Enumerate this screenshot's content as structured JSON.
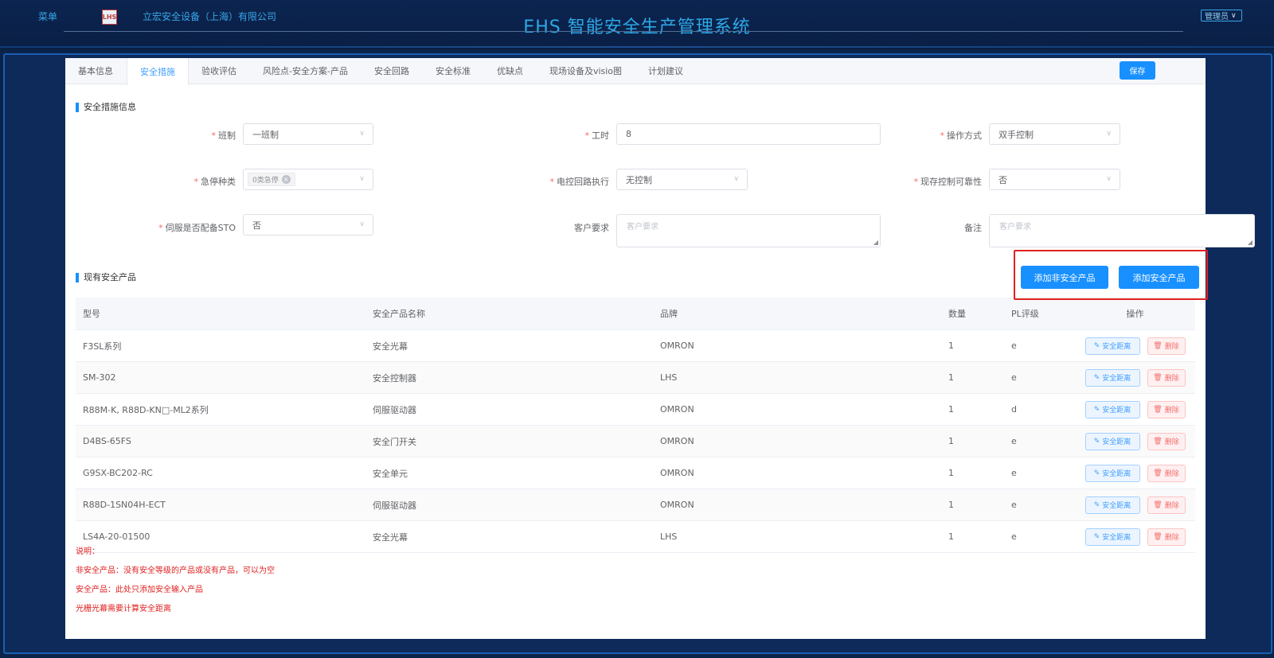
{
  "header": {
    "menu": "菜单",
    "logo_text": "LHS",
    "company": "立宏安全设备（上海）有限公司",
    "system_title": "EHS 智能安全生产管理系统",
    "user": "管理员"
  },
  "tabs": [
    {
      "label": "基本信息"
    },
    {
      "label": "安全措施",
      "active": true
    },
    {
      "label": "验收评估"
    },
    {
      "label": "风险点-安全方案-产品"
    },
    {
      "label": "安全回路"
    },
    {
      "label": "安全标准"
    },
    {
      "label": "优缺点"
    },
    {
      "label": "现场设备及visio图"
    },
    {
      "label": "计划建议"
    }
  ],
  "toolbar": {
    "save_label": "保存"
  },
  "section_measures": "安全措施信息",
  "form": {
    "shift_label": "班制",
    "shift_value": "一班制",
    "hours_label": "工时",
    "hours_value": "8",
    "operation_label": "操作方式",
    "operation_value": "双手控制",
    "estop_label": "急停种类",
    "estop_tag": "0类急停",
    "circuit_label": "电控回路执行",
    "circuit_value": "无控制",
    "reliability_label": "现存控制可靠性",
    "reliability_value": "否",
    "sto_label": "伺服是否配备STO",
    "sto_value": "否",
    "customer_label": "客户要求",
    "customer_placeholder": "客户要求",
    "remark_label": "备注",
    "remark_placeholder": "客户要求"
  },
  "section_products": "现有安全产品",
  "actions": {
    "add_non_safety": "添加非安全产品",
    "add_safety": "添加安全产品"
  },
  "table": {
    "headers": {
      "model": "型号",
      "name": "安全产品名称",
      "brand": "品牌",
      "qty": "数量",
      "pl": "PL评级",
      "op": "操作"
    },
    "row_actions": {
      "distance": "安全距离",
      "delete": "删除"
    },
    "rows": [
      {
        "model": "F3SL系列",
        "name": "安全光幕",
        "brand": "OMRON",
        "qty": "1",
        "pl": "e"
      },
      {
        "model": "SM-302",
        "name": "安全控制器",
        "brand": "LHS",
        "qty": "1",
        "pl": "e"
      },
      {
        "model": "R88M-K, R88D-KN□-ML2系列",
        "name": "伺服驱动器",
        "brand": "OMRON",
        "qty": "1",
        "pl": "d"
      },
      {
        "model": "D4BS-65FS",
        "name": "安全门开关",
        "brand": "OMRON",
        "qty": "1",
        "pl": "e"
      },
      {
        "model": "G9SX-BC202-RC",
        "name": "安全单元",
        "brand": "OMRON",
        "qty": "1",
        "pl": "e"
      },
      {
        "model": "R88D-1SN04H-ECT",
        "name": "伺服驱动器",
        "brand": "OMRON",
        "qty": "1",
        "pl": "e"
      },
      {
        "model": "LS4A-20-01500",
        "name": "安全光幕",
        "brand": "LHS",
        "qty": "1",
        "pl": "e"
      }
    ]
  },
  "notes": [
    "说明：",
    "非安全产品：没有安全等级的产品或没有产品，可以为空",
    "安全产品：此处只添加安全输入产品",
    "光栅光幕需要计算安全距离"
  ]
}
